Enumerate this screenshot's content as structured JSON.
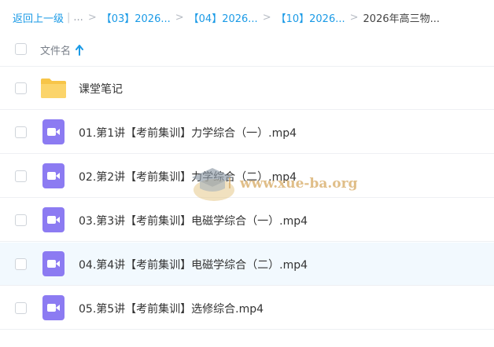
{
  "breadcrumb": {
    "back_label": "返回上一级",
    "ellipsis": "...",
    "items": [
      "【03】2026...",
      "【04】2026...",
      "【10】2026..."
    ],
    "current": "2026年高三物..."
  },
  "table": {
    "column_name": "文件名",
    "sort": "ascending",
    "sort_icon": "arrow-up-icon"
  },
  "files": [
    {
      "name": "课堂笔记",
      "type": "folder",
      "icon": "folder-icon"
    },
    {
      "name": "01.第1讲【考前集训】力学综合（一）.mp4",
      "type": "video",
      "icon": "video-icon"
    },
    {
      "name": "02.第2讲【考前集训】力学综合（二）.mp4",
      "type": "video",
      "icon": "video-icon"
    },
    {
      "name": "03.第3讲【考前集训】电磁学综合（一）.mp4",
      "type": "video",
      "icon": "video-icon"
    },
    {
      "name": "04.第4讲【考前集训】电磁学综合（二）.mp4",
      "type": "video",
      "icon": "video-icon"
    },
    {
      "name": "05.第5讲【考前集训】选修综合.mp4",
      "type": "video",
      "icon": "video-icon"
    }
  ],
  "hovered_row_index": 4,
  "watermark": {
    "text": "www.xue-ba.org"
  },
  "colors": {
    "link": "#1a9ae6",
    "folder": "#f7c548",
    "video": "#8c7bf2",
    "hover_row": "#f2f9fe",
    "watermark": "#d6a860"
  }
}
